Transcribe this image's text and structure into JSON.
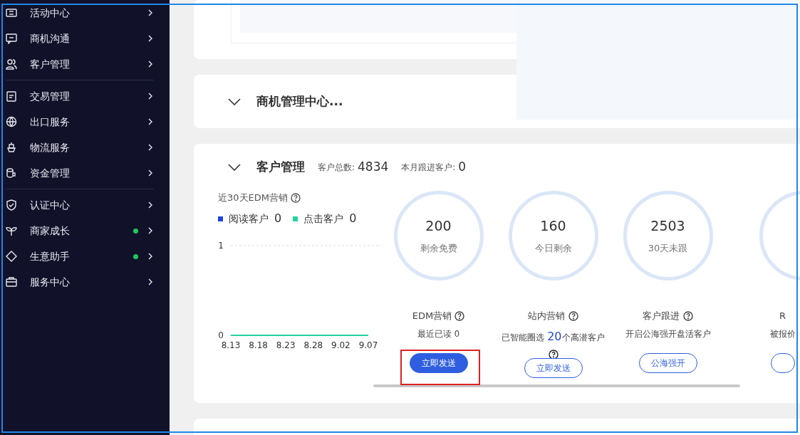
{
  "sidebar": {
    "groups": [
      {
        "items": [
          {
            "label": "活动中心",
            "dot": false
          },
          {
            "label": "商机沟通",
            "dot": false
          },
          {
            "label": "客户管理",
            "dot": false
          }
        ]
      },
      {
        "items": [
          {
            "label": "交易管理",
            "dot": false
          },
          {
            "label": "出口服务",
            "dot": false
          },
          {
            "label": "物流服务",
            "dot": false
          },
          {
            "label": "资金管理",
            "dot": false
          }
        ]
      },
      {
        "items": [
          {
            "label": "认证中心",
            "dot": false
          },
          {
            "label": "商家成长",
            "dot": true
          },
          {
            "label": "生意助手",
            "dot": true
          },
          {
            "label": "服务中心",
            "dot": false
          }
        ]
      }
    ]
  },
  "opportunity_section": {
    "title": "商机管理中心...",
    "expanded": true
  },
  "customer_section": {
    "title": "客户管理",
    "expanded": true,
    "summary": [
      {
        "label": "客户总数:",
        "value": "4834"
      },
      {
        "label": "本月跟进客户:",
        "value": "0"
      }
    ],
    "edm_chart": {
      "title": "近30天EDM营销",
      "legend": [
        {
          "name": "阅读客户",
          "color": "#1f44d8",
          "value": "0"
        },
        {
          "value": "0"
        }
      ],
      "chart_data": {
        "type": "line",
        "categories": [
          "8.13",
          "8.18",
          "8.23",
          "8.28",
          "9.02",
          "9.07"
        ],
        "yticks": [
          0,
          1
        ],
        "ylim": [
          0,
          1
        ],
        "series": [
          {
            "name": "点击客户",
            "color": "#22d3a0",
            "values": [
              0,
              0,
              0,
              0,
              0,
              0
            ]
          }
        ]
      }
    },
    "stats": [
      {
        "value": "200",
        "caption": "剩余免费",
        "title": "EDM营销",
        "desc": "最近已读 0",
        "button": "立即发送",
        "primary": true,
        "highlighted": true
      },
      {
        "value": "160",
        "caption": "今日剩余",
        "title": "站内营销",
        "desc": "已智能圈选 **20**个高潜客户",
        "desc_help": true,
        "button": "立即发送",
        "primary": false,
        "highlighted": false
      },
      {
        "value": "2503",
        "caption": "30天未跟",
        "title": "客户跟进",
        "desc": "开启公海强开盘活客户",
        "button": "公海强开",
        "primary": false,
        "highlighted": false
      },
      {
        "title": "R",
        "desc": "被报价",
        "primary": false,
        "highlighted": false,
        "partial": true
      }
    ]
  }
}
